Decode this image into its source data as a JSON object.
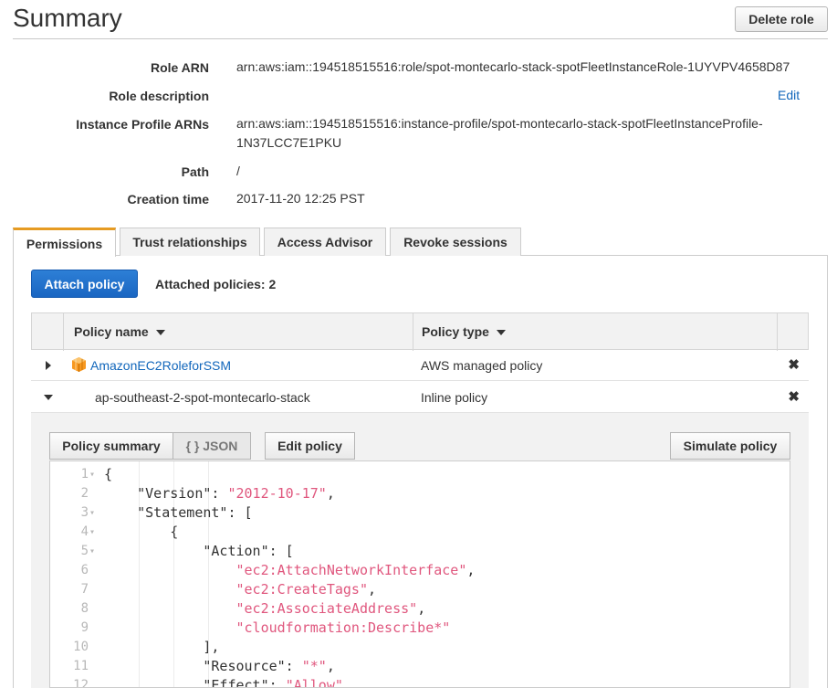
{
  "page": {
    "title": "Summary",
    "delete_label": "Delete role"
  },
  "summary": {
    "role_arn_label": "Role ARN",
    "role_arn": "arn:aws:iam::194518515516:role/spot-montecarlo-stack-spotFleetInstanceRole-1UYVPV4658D87",
    "role_description_label": "Role description",
    "edit_label": "Edit",
    "instance_profile_label": "Instance Profile ARNs",
    "instance_profile_line1": "arn:aws:iam::194518515516:instance-profile/spot-montecarlo-stack-spotFleetInstanceProfile-",
    "instance_profile_line2": "1N37LCC7E1PKU",
    "path_label": "Path",
    "path": "/",
    "creation_label": "Creation time",
    "creation": "2017-11-20 12:25 PST"
  },
  "tabs": [
    {
      "label": "Permissions"
    },
    {
      "label": "Trust relationships"
    },
    {
      "label": "Access Advisor"
    },
    {
      "label": "Revoke sessions"
    }
  ],
  "permissions": {
    "attach_label": "Attach policy",
    "attached_count": "Attached policies: 2",
    "col_policy_name": "Policy name",
    "col_policy_type": "Policy type",
    "rows": [
      {
        "name": "AmazonEC2RoleforSSM",
        "type": "AWS managed policy"
      },
      {
        "name": "ap-southeast-2-spot-montecarlo-stack",
        "type": "Inline policy"
      }
    ]
  },
  "policy_view": {
    "summary_label": "Policy summary",
    "json_label": "{ } JSON",
    "edit_label": "Edit policy",
    "simulate_label": "Simulate policy",
    "lines": [
      {
        "n": "1",
        "fold": true,
        "parts": [
          [
            "p",
            "{"
          ]
        ]
      },
      {
        "n": "2",
        "fold": false,
        "parts": [
          [
            "p",
            "    \"Version\": "
          ],
          [
            "s",
            "\"2012-10-17\""
          ],
          [
            "p",
            ","
          ]
        ]
      },
      {
        "n": "3",
        "fold": true,
        "parts": [
          [
            "p",
            "    \"Statement\": ["
          ]
        ]
      },
      {
        "n": "4",
        "fold": true,
        "parts": [
          [
            "p",
            "        {"
          ]
        ]
      },
      {
        "n": "5",
        "fold": true,
        "parts": [
          [
            "p",
            "            \"Action\": ["
          ]
        ]
      },
      {
        "n": "6",
        "fold": false,
        "parts": [
          [
            "p",
            "                "
          ],
          [
            "s",
            "\"ec2:AttachNetworkInterface\""
          ],
          [
            "p",
            ","
          ]
        ]
      },
      {
        "n": "7",
        "fold": false,
        "parts": [
          [
            "p",
            "                "
          ],
          [
            "s",
            "\"ec2:CreateTags\""
          ],
          [
            "p",
            ","
          ]
        ]
      },
      {
        "n": "8",
        "fold": false,
        "parts": [
          [
            "p",
            "                "
          ],
          [
            "s",
            "\"ec2:AssociateAddress\""
          ],
          [
            "p",
            ","
          ]
        ]
      },
      {
        "n": "9",
        "fold": false,
        "parts": [
          [
            "p",
            "                "
          ],
          [
            "s",
            "\"cloudformation:Describe*\""
          ]
        ]
      },
      {
        "n": "10",
        "fold": false,
        "parts": [
          [
            "p",
            "            ],"
          ]
        ]
      },
      {
        "n": "11",
        "fold": false,
        "parts": [
          [
            "p",
            "            \"Resource\": "
          ],
          [
            "s",
            "\"*\""
          ],
          [
            "p",
            ","
          ]
        ]
      },
      {
        "n": "12",
        "fold": false,
        "parts": [
          [
            "p",
            "            \"Effect\": "
          ],
          [
            "s",
            "\"Allow\""
          ]
        ]
      }
    ]
  },
  "colors": {
    "accent_tab": "#e69b22",
    "primary": "#1a66c2",
    "link": "#1166bb",
    "string": "#e0577e"
  },
  "icons": {
    "expand_collapsed": "caret-right-icon",
    "expand_open": "caret-down-icon",
    "remove": "close-x-icon",
    "managed_policy": "aws-cube-icon",
    "sort": "sort-caret-icon"
  }
}
